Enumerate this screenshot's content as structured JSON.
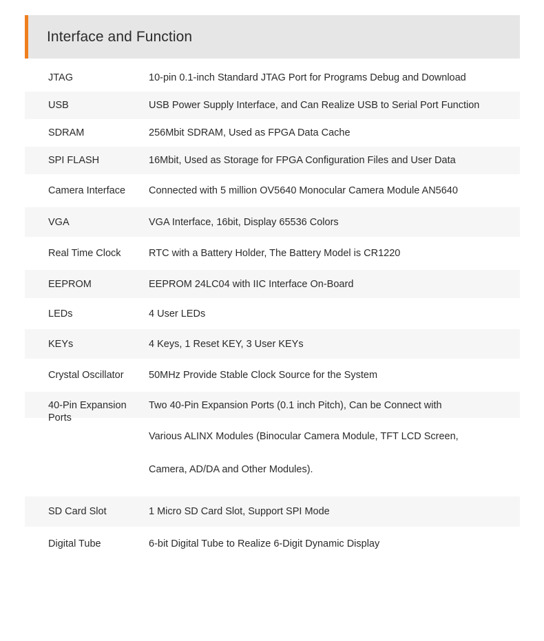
{
  "header": {
    "title": "Interface and Function",
    "accent_color": "#ef7f1f",
    "band_color": "#e6e6e6"
  },
  "table": {
    "stripe_color": "#f6f6f6",
    "rows": [
      {
        "label": "JTAG",
        "desc": "10-pin 0.1-inch Standard JTAG Port for Programs Debug and Download"
      },
      {
        "label": "USB",
        "desc": "USB Power Supply Interface, and Can Realize USB to Serial Port Function"
      },
      {
        "label": "SDRAM",
        "desc": "256Mbit SDRAM, Used as FPGA Data Cache"
      },
      {
        "label": "SPI FLASH",
        "desc": "16Mbit, Used as Storage for FPGA Configuration Files and User Data"
      },
      {
        "label": "Camera Interface",
        "desc": "Connected with 5 million OV5640 Monocular Camera Module AN5640"
      },
      {
        "label": "VGA",
        "desc": "VGA Interface, 16bit, Display 65536 Colors"
      },
      {
        "label": "Real Time Clock",
        "desc": "RTC with a Battery Holder, The Battery Model is CR1220"
      },
      {
        "label": "EEPROM",
        "desc": "EEPROM 24LC04 with IIC Interface On-Board"
      },
      {
        "label": "LEDs",
        "desc": "4 User LEDs"
      },
      {
        "label": "KEYs",
        "desc": "4 Keys, 1 Reset KEY, 3 User KEYs"
      },
      {
        "label": "Crystal Oscillator",
        "desc": "50MHz Provide Stable Clock Source for the System"
      },
      {
        "label": "40-Pin Expansion Ports",
        "desc_line1": "Two 40-Pin Expansion Ports (0.1 inch Pitch), Can be Connect with",
        "desc_line2": "Various ALINX Modules (Binocular Camera Module, TFT LCD Screen,",
        "desc_line3": "Camera, AD/DA and Other Modules)."
      },
      {
        "label": "SD Card Slot",
        "desc": "1 Micro SD Card Slot,  Support SPI Mode"
      },
      {
        "label": "Digital Tube",
        "desc": "6-bit Digital Tube to Realize 6-Digit Dynamic Display"
      }
    ]
  }
}
